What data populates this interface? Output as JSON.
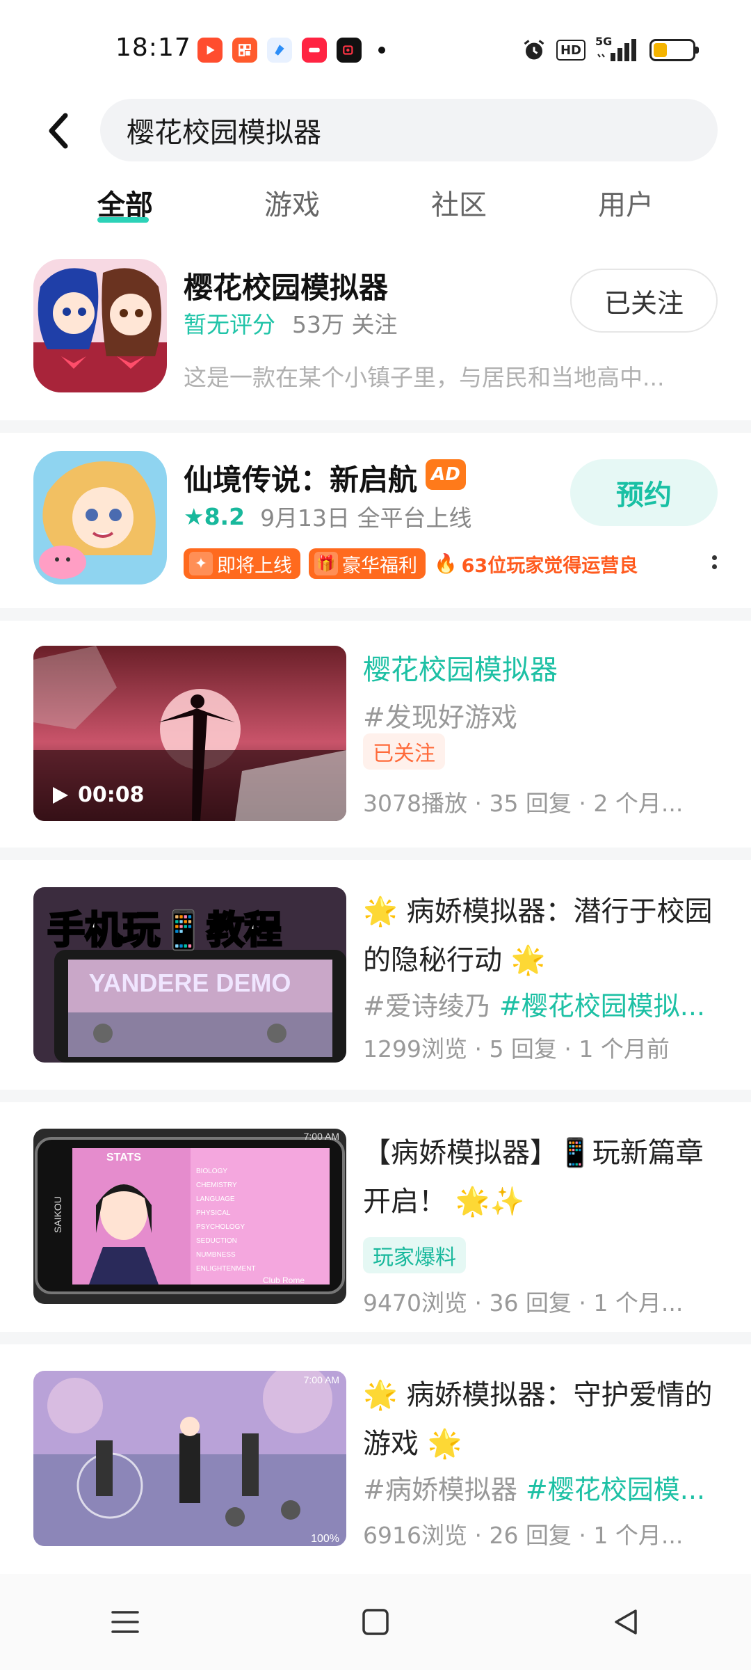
{
  "status_bar": {
    "time": "18:17",
    "hd_label": "HD",
    "network": "5G",
    "battery_level": 0.35,
    "app_icons": [
      {
        "name": "video-app-icon",
        "color": "#ff4d2e"
      },
      {
        "name": "grid-app-icon",
        "color": "#ff5a2c"
      },
      {
        "name": "blue-app-icon",
        "color": "#2c8ef8"
      },
      {
        "name": "xiaohongshu-app-icon",
        "color": "#ff2442"
      },
      {
        "name": "record-app-icon",
        "color": "#111111"
      }
    ]
  },
  "search": {
    "query": "樱花校园模拟器"
  },
  "tabs": [
    {
      "label": "全部",
      "active": true
    },
    {
      "label": "游戏",
      "active": false
    },
    {
      "label": "社区",
      "active": false
    },
    {
      "label": "用户",
      "active": false
    }
  ],
  "game_card": {
    "title": "樱花校园模拟器",
    "rating": "暂无评分",
    "followers": "53万 关注",
    "description": "这是一款在某个小镇子里，与居民和当地高中...",
    "follow_label": "已关注"
  },
  "ad_card": {
    "title": "仙境传说：新启航",
    "badge": "AD",
    "score": "8.2",
    "release": "9月13日 全平台上线",
    "button": "预约",
    "tags": [
      {
        "label": "即将上线",
        "icon": "✦"
      },
      {
        "label": "豪华福利",
        "icon": "🎁"
      },
      {
        "label": "63位玩家觉得运营良",
        "icon": "🔥"
      }
    ]
  },
  "posts": [
    {
      "title": "樱花校园模拟器",
      "tags_text": "#发现好游戏",
      "pill": "已关注",
      "stats": "3078播放 · 35 回复 · 2 个月...",
      "duration": "00:08"
    },
    {
      "title": "🌟 病娇模拟器：潜行于校园的隐秘行动 🌟",
      "tag_plain": "#爱诗绫乃 ",
      "tag_highlight": "#樱花校园模拟...",
      "stats": "1299浏览 · 5 回复 · 1 个月前",
      "thumb_text": "手机玩📱教程",
      "thumb_sub": "YANDERE DEMO"
    },
    {
      "title": "【病娇模拟器】📱玩新篇章开启！ 🌟✨",
      "pill": "玩家爆料",
      "stats": "9470浏览 · 36 回复 · 1 个月...",
      "thumb_time": "7:00 AM",
      "thumb_text": "STATS",
      "thumb_side": "SAIKOU",
      "thumb_stats": [
        "BIOLOGY",
        "CHEMISTRY",
        "LANGUAGE",
        "PHYSICAL",
        "PSYCHOLOGY",
        "SEDUCTION",
        "NUMBNESS",
        "ENLIGHTENMENT"
      ],
      "thumb_footer": "Club Rome"
    },
    {
      "title": "🌟 病娇模拟器：守护爱情的游戏 🌟",
      "tag_plain": "#病娇模拟器 ",
      "tag_highlight": "#樱花校园模...",
      "stats": "6916浏览 · 26 回复 · 1 个月...",
      "thumb_time": "7:00 AM",
      "thumb_zoom": "100%"
    }
  ]
}
